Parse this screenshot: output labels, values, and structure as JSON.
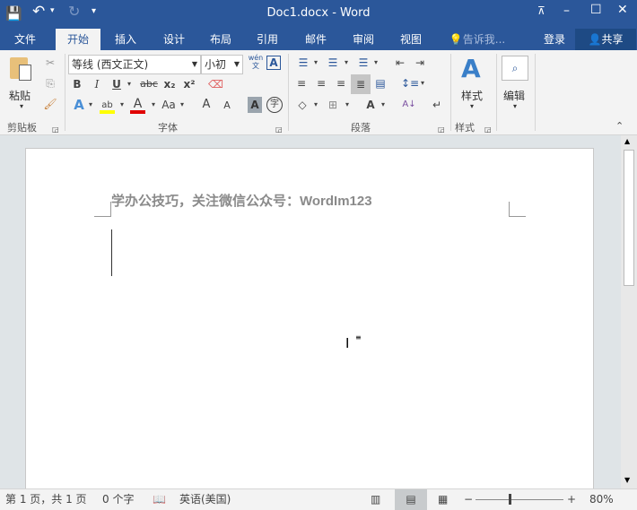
{
  "window": {
    "title": "Doc1.docx - Word"
  },
  "qat": {
    "save": "save-icon",
    "undo": "↶",
    "redo": "↻",
    "customize": "▾"
  },
  "tabs": [
    {
      "label": "文件"
    },
    {
      "label": "开始"
    },
    {
      "label": "插入"
    },
    {
      "label": "设计"
    },
    {
      "label": "布局"
    },
    {
      "label": "引用"
    },
    {
      "label": "邮件"
    },
    {
      "label": "审阅"
    },
    {
      "label": "视图"
    }
  ],
  "tellme": "告诉我...",
  "signin": "登录",
  "share": "共享",
  "ribbon": {
    "clipboard": {
      "label": "剪贴板",
      "paste": "粘贴"
    },
    "font": {
      "label": "字体",
      "font_name": "等线 (西文正文)",
      "font_size": "小初",
      "bold": "B",
      "italic": "I",
      "underline": "U",
      "strike": "abc",
      "sub": "x₂",
      "sup": "x²",
      "change_case": "Aa",
      "grow": "A",
      "shrink": "A",
      "phonetic_top": "wén",
      "phonetic_bottom": "文",
      "char_border": "A",
      "char_shading": "A",
      "enclose": "字",
      "font_color": "#e00000",
      "highlight_color": "#ffff00"
    },
    "paragraph": {
      "label": "段落"
    },
    "styles": {
      "label": "样式",
      "button": "样式"
    },
    "editing": {
      "button": "编辑"
    }
  },
  "document": {
    "text": "学办公技巧，关注微信公众号：WordIm123"
  },
  "status": {
    "page": "第 1 页，共 1 页",
    "words": "0 个字",
    "language": "英语(美国)",
    "zoom": "80%",
    "zoom_percent": 80
  }
}
